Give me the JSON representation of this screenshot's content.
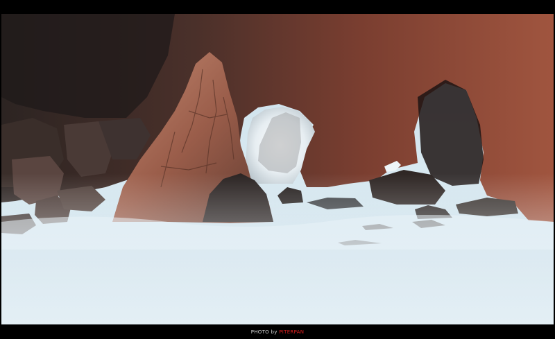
{
  "caption": {
    "prefix": "PHOTO by",
    "name": "PITERPAN"
  },
  "colors": {
    "frame": "#000000",
    "caption_prefix": "#d8d8d8",
    "caption_name": "#e02020",
    "rock_warm": "#a85a44",
    "water": "#cfe3ee"
  },
  "scene": {
    "subject": "sea-arch-rocks",
    "feature": "misty-long-exposure-surf"
  }
}
